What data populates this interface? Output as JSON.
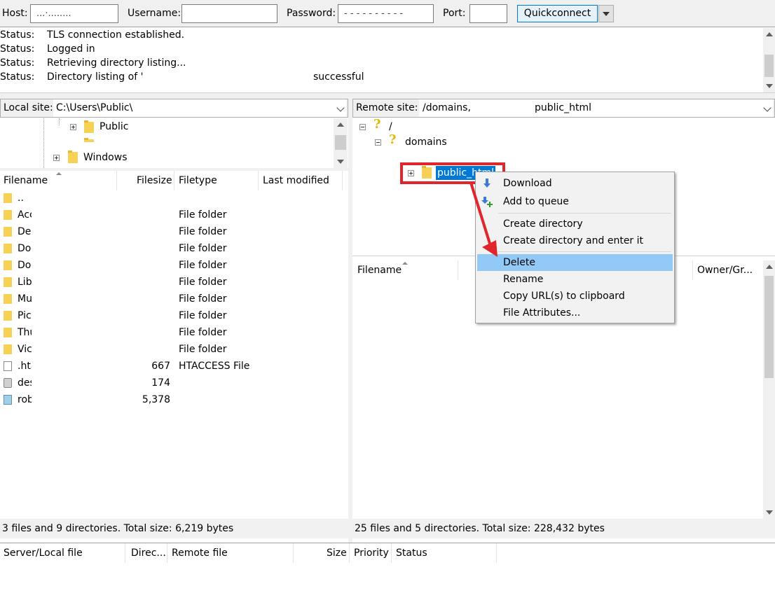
{
  "quickconnect": {
    "host_label": "Host:",
    "host_value": "...·........",
    "username_label": "Username:",
    "username_value": "",
    "password_label": "Password:",
    "password_value": "- - - - - - - - - -",
    "port_label": "Port:",
    "port_value": "",
    "connect_label": "Quickconnect"
  },
  "log": [
    {
      "label": "Status:",
      "message": "TLS connection established.",
      "tail": ""
    },
    {
      "label": "Status:",
      "message": "Logged in",
      "tail": ""
    },
    {
      "label": "Status:",
      "message": "Retrieving directory listing...",
      "tail": ""
    },
    {
      "label": "Status:",
      "message": "Directory listing of '",
      "tail": "successful"
    }
  ],
  "local": {
    "site_label": "Local site:",
    "path": "C:\\Users\\Public\\",
    "tree": [
      {
        "name": "Public"
      },
      {
        "name": "Windows"
      }
    ],
    "columns": {
      "filename": "Filename",
      "filesize": "Filesize",
      "filetype": "Filetype",
      "modified": "Last modified"
    },
    "rows": [
      {
        "name": "..",
        "size": "",
        "type": "",
        "icon": "folder-icon"
      },
      {
        "name": "Acc",
        "size": "",
        "type": "File folder",
        "icon": "folder-icon"
      },
      {
        "name": "De",
        "size": "",
        "type": "File folder",
        "icon": "folder-icon"
      },
      {
        "name": "Do",
        "size": "",
        "type": "File folder",
        "icon": "folder-icon"
      },
      {
        "name": "Do",
        "size": "",
        "type": "File folder",
        "icon": "folder-icon"
      },
      {
        "name": "Lib",
        "size": "",
        "type": "File folder",
        "icon": "folder-icon"
      },
      {
        "name": "Mu",
        "size": "",
        "type": "File folder",
        "icon": "folder-icon"
      },
      {
        "name": "Pic",
        "size": "",
        "type": "File folder",
        "icon": "folder-icon"
      },
      {
        "name": "Thu",
        "size": "",
        "type": "File folder",
        "icon": "folder-icon"
      },
      {
        "name": "Vic",
        "size": "",
        "type": "File folder",
        "icon": "folder-icon"
      },
      {
        "name": ".hta",
        "size": "667",
        "type": "HTACCESS File",
        "icon": "file-icon"
      },
      {
        "name": "des",
        "size": "174",
        "type": "",
        "icon": "settings-file-icon"
      },
      {
        "name": "rob",
        "size": "5,378",
        "type": "",
        "icon": "package-icon"
      }
    ],
    "status": "3 files and 9 directories. Total size: 6,219 bytes"
  },
  "remote": {
    "site_label": "Remote site:",
    "path": "/domains,",
    "path_tail": "public_html",
    "tree": [
      {
        "name": "/"
      },
      {
        "name": "domains"
      },
      {
        "name": "public_html"
      }
    ],
    "columns": {
      "filename": "Filename",
      "owner": "Owner/Gr..."
    },
    "status": "25 files and 5 directories. Total size: 228,432 bytes"
  },
  "context_menu": {
    "items": [
      {
        "label": "Download",
        "icon": "download-icon"
      },
      {
        "label": "Add to queue",
        "icon": "add-to-queue-icon"
      },
      {
        "label": "Create directory"
      },
      {
        "label": "Create directory and enter it"
      },
      {
        "label": "Delete",
        "highlighted": true
      },
      {
        "label": "Rename"
      },
      {
        "label": "Copy URL(s) to clipboard"
      },
      {
        "label": "File Attributes..."
      }
    ]
  },
  "queue": {
    "columns": [
      "Server/Local file",
      "Direc...",
      "Remote file",
      "Size",
      "Priority",
      "Status"
    ]
  },
  "colors": {
    "selection": "#0078d7",
    "menu_highlight": "#91c9f7",
    "annotation_red": "#e0252c",
    "folder": "#f7d155"
  }
}
